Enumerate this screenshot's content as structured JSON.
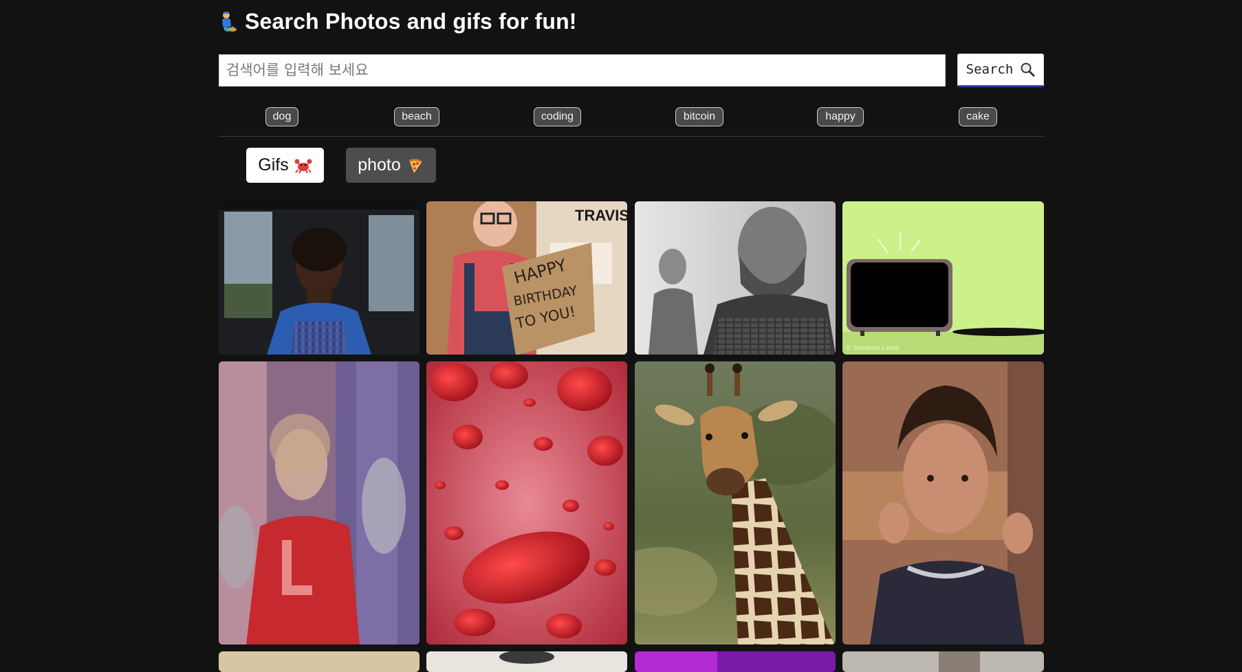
{
  "header": {
    "title": "Search Photos and gifs for fun!",
    "title_icon": "genie-icon"
  },
  "search": {
    "placeholder": "검색어를 입력해 보세요",
    "value": "",
    "button_label": "Search",
    "button_icon": "magnifier-icon"
  },
  "tags": [
    "dog",
    "beach",
    "coding",
    "bitcoin",
    "happy",
    "cake"
  ],
  "tabs": [
    {
      "label": "Gifs",
      "icon": "crab-icon",
      "active": true
    },
    {
      "label": "photo",
      "icon": "pizza-icon",
      "active": false
    }
  ],
  "results": [
    {
      "name": "result-woman-in-car"
    },
    {
      "name": "result-happy-birthday-sign",
      "text": "TRAVIS"
    },
    {
      "name": "result-bearded-man-grayscale"
    },
    {
      "name": "result-tv-cartoon",
      "text": "© Susanne Lamb"
    },
    {
      "name": "result-cheerleader"
    },
    {
      "name": "result-red-blood-cells"
    },
    {
      "name": "result-giraffe"
    },
    {
      "name": "result-boy-gesturing"
    }
  ],
  "colors": {
    "background": "#121212",
    "tag_background": "#4a4a4a",
    "tab_inactive": "#4d4d4d",
    "search_button_underline": "#2b3a9e"
  }
}
